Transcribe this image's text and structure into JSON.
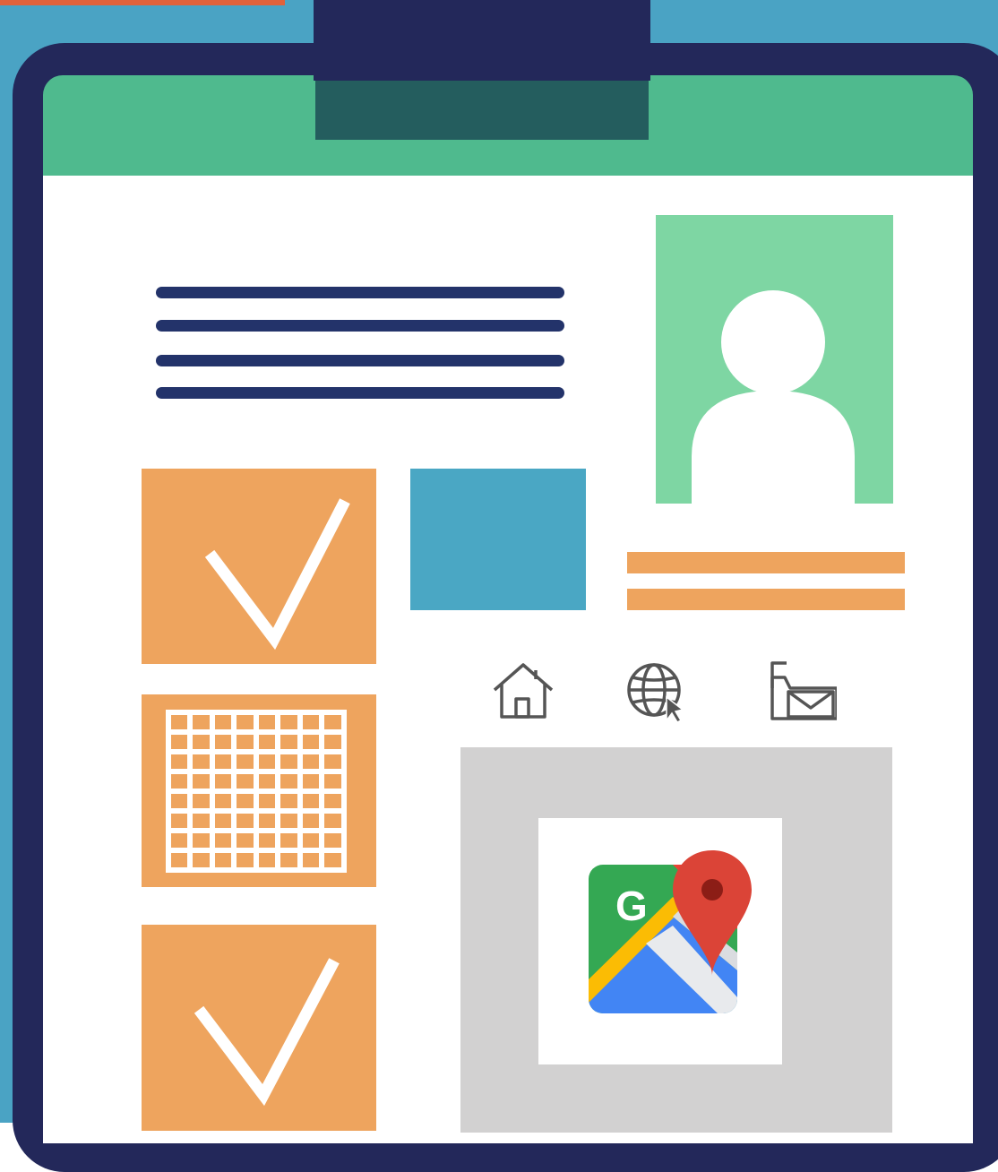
{
  "colors": {
    "background": "#4aa3c4",
    "corner_tab": "#e0623b",
    "board": "#23285a",
    "header_green": "#4fba8e",
    "clip_inner": "#245d5e",
    "paper": "#ffffff",
    "text_lines": "#23336a",
    "photo_bg": "#7ed6a3",
    "photo_person": "#ffffff",
    "orange": "#eea45e",
    "blue_block": "#4aa7c4",
    "map_panel": "#d2d1d1",
    "map_card": "#ffffff",
    "icon_stroke": "#555555"
  },
  "tiles": [
    {
      "name": "checkmark-tile",
      "icon": "check-icon"
    },
    {
      "name": "grid-tile",
      "icon": "grid-icon"
    },
    {
      "name": "checkmark-tile",
      "icon": "check-icon"
    }
  ],
  "toolbar_icons": [
    "home-icon",
    "globe-cursor-icon",
    "folder-mail-icon"
  ],
  "map_app": {
    "icon": "google-maps-icon",
    "glyph": "G"
  }
}
